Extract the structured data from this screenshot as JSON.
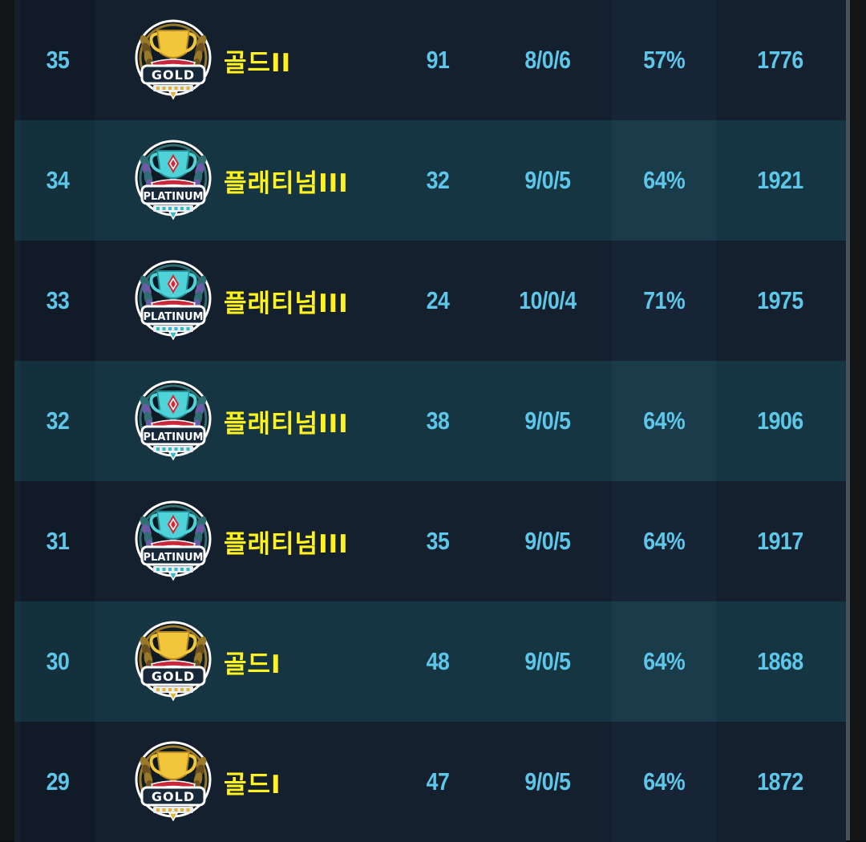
{
  "colors": {
    "value_text": "#5ec6e8",
    "tier_text": "#fff21e",
    "row_dark": "#14202e",
    "row_teal": "#163543",
    "gold_badge": "#e0b43a",
    "platinum_badge": "#35b9c4"
  },
  "rows": [
    {
      "rank": "35",
      "tier_badge": "GOLD",
      "tier_badge_icon": "gold-trophy-icon",
      "tier": "골드II",
      "points": "91",
      "record": "8/0/6",
      "win_rate": "57%",
      "rating": "1776"
    },
    {
      "rank": "34",
      "tier_badge": "PLATINUM",
      "tier_badge_icon": "platinum-trophy-icon",
      "tier": "플래티넘III",
      "points": "32",
      "record": "9/0/5",
      "win_rate": "64%",
      "rating": "1921"
    },
    {
      "rank": "33",
      "tier_badge": "PLATINUM",
      "tier_badge_icon": "platinum-trophy-icon",
      "tier": "플래티넘III",
      "points": "24",
      "record": "10/0/4",
      "win_rate": "71%",
      "rating": "1975"
    },
    {
      "rank": "32",
      "tier_badge": "PLATINUM",
      "tier_badge_icon": "platinum-trophy-icon",
      "tier": "플래티넘III",
      "points": "38",
      "record": "9/0/5",
      "win_rate": "64%",
      "rating": "1906"
    },
    {
      "rank": "31",
      "tier_badge": "PLATINUM",
      "tier_badge_icon": "platinum-trophy-icon",
      "tier": "플래티넘III",
      "points": "35",
      "record": "9/0/5",
      "win_rate": "64%",
      "rating": "1917"
    },
    {
      "rank": "30",
      "tier_badge": "GOLD",
      "tier_badge_icon": "gold-trophy-icon",
      "tier": "골드I",
      "points": "48",
      "record": "9/0/5",
      "win_rate": "64%",
      "rating": "1868"
    },
    {
      "rank": "29",
      "tier_badge": "GOLD",
      "tier_badge_icon": "gold-trophy-icon",
      "tier": "골드I",
      "points": "47",
      "record": "9/0/5",
      "win_rate": "64%",
      "rating": "1872"
    }
  ]
}
